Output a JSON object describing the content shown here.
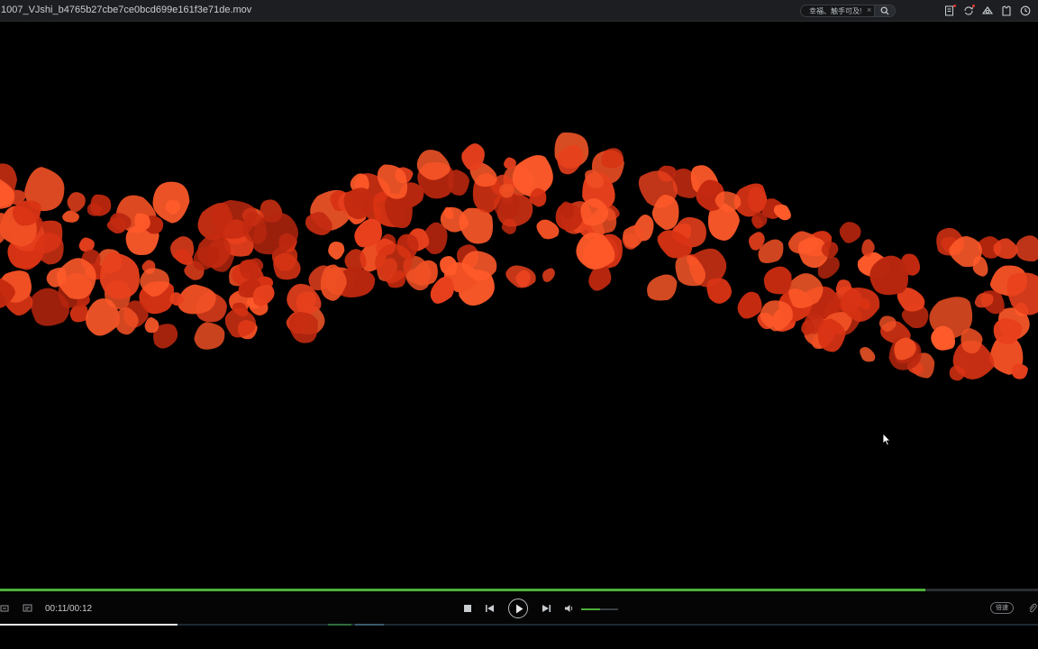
{
  "window": {
    "title": "1007_VJshi_b4765b27cbe7ce0bcd699e161f3e71de.mov"
  },
  "search": {
    "value": "幸福、触手可及!",
    "clear_glyph": "×"
  },
  "toolbar_icons": [
    "document-icon",
    "sync-icon",
    "cloth-icon",
    "shirt-icon",
    "clock-icon"
  ],
  "playback": {
    "time_display": "00:11/00:12",
    "progress_fraction": 0.944,
    "volume_fraction": 0.5,
    "speed_label": "倍速"
  },
  "colors": {
    "accent_green": "#4caf3a",
    "petal_red": "#e23a1a",
    "background": "#000000"
  }
}
